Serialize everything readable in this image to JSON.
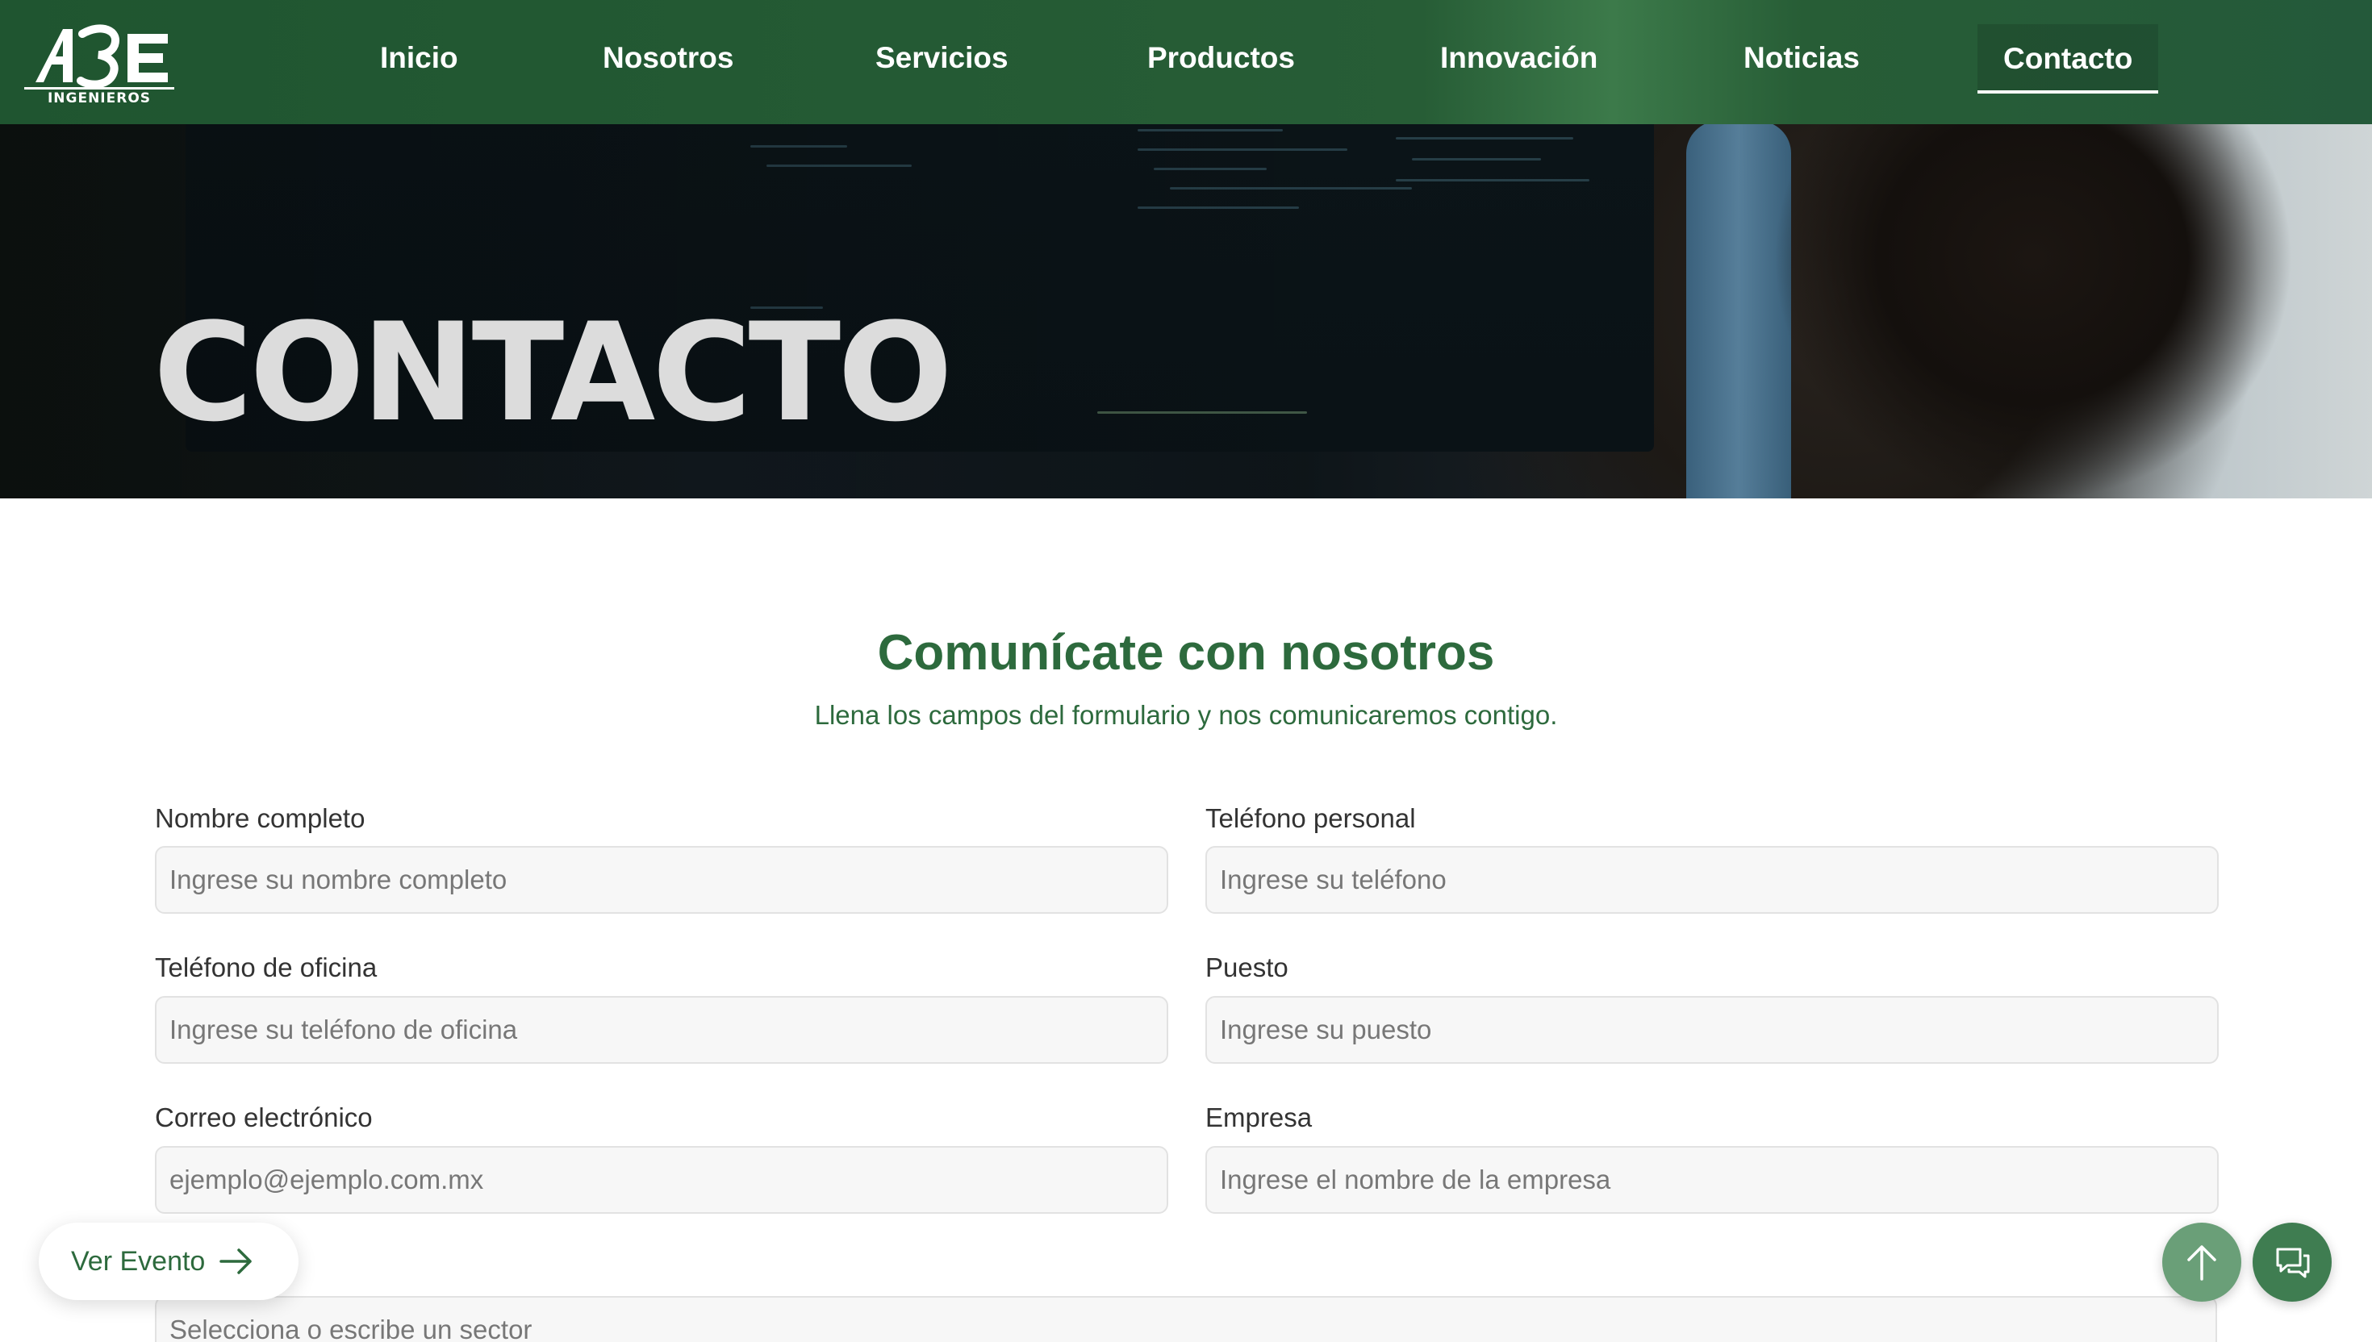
{
  "header": {
    "logo_text": "INGENIEROS",
    "logo_mark": "ABE",
    "nav": [
      {
        "label": "Inicio"
      },
      {
        "label": "Nosotros"
      },
      {
        "label": "Servicios"
      },
      {
        "label": "Productos"
      },
      {
        "label": "Innovación"
      },
      {
        "label": "Noticias"
      },
      {
        "label": "Contacto",
        "active": true
      }
    ]
  },
  "hero": {
    "title": "CONTACTO"
  },
  "contact": {
    "title": "Comunícate con nosotros",
    "subtitle": "Llena los campos del formulario y nos comunicaremos contigo.",
    "fields": {
      "nombre": {
        "label": "Nombre completo",
        "placeholder": "Ingrese su nombre completo",
        "value": ""
      },
      "telefono": {
        "label": "Teléfono personal",
        "placeholder": "Ingrese su teléfono",
        "value": ""
      },
      "tel_oficina": {
        "label": "Teléfono de oficina",
        "placeholder": "Ingrese su teléfono de oficina",
        "value": ""
      },
      "puesto": {
        "label": "Puesto",
        "placeholder": "Ingrese su puesto",
        "value": ""
      },
      "correo": {
        "label": "Correo electrónico",
        "placeholder": "ejemplo@ejemplo.com.mx",
        "value": ""
      },
      "empresa": {
        "label": "Empresa",
        "placeholder": "Ingrese el nombre de la empresa",
        "value": ""
      },
      "sector": {
        "placeholder": "Selecciona o escribe un sector",
        "value": ""
      }
    }
  },
  "floating": {
    "ver_evento_label": "Ver Evento",
    "ver_evento_icon": "arrow-right-icon",
    "scroll_top_icon": "arrow-up-icon",
    "chat_icon": "chat-icon"
  },
  "colors": {
    "brand_green": "#2d6a3d",
    "nav_green": "#275d36",
    "fab_light": "#6a9f78",
    "fab_dark": "#3f7d51"
  }
}
